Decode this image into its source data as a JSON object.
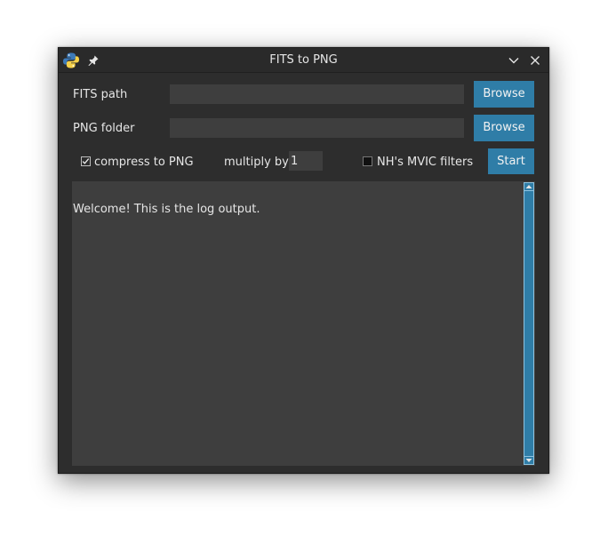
{
  "window": {
    "title": "FITS to PNG",
    "icons": {
      "app": "python-icon",
      "pin": "pin-icon",
      "minimize": "chevron-down-icon",
      "close": "close-icon"
    }
  },
  "form": {
    "fits_path": {
      "label": "FITS path",
      "value": "",
      "button": "Browse"
    },
    "png_folder": {
      "label": "PNG folder",
      "value": "",
      "button": "Browse"
    },
    "compress": {
      "label": "compress to PNG",
      "checked": true
    },
    "multiply": {
      "label": "multiply by",
      "value": "1"
    },
    "mvic": {
      "label": "NH's MVIC filters",
      "checked": false
    },
    "start_button": "Start"
  },
  "log": {
    "text": "Welcome! This is the log output."
  },
  "colors": {
    "accent": "#2f7da7",
    "window_bg": "#2d2d2d",
    "field_bg": "#3e3e3e",
    "text": "#e6e6e6"
  }
}
